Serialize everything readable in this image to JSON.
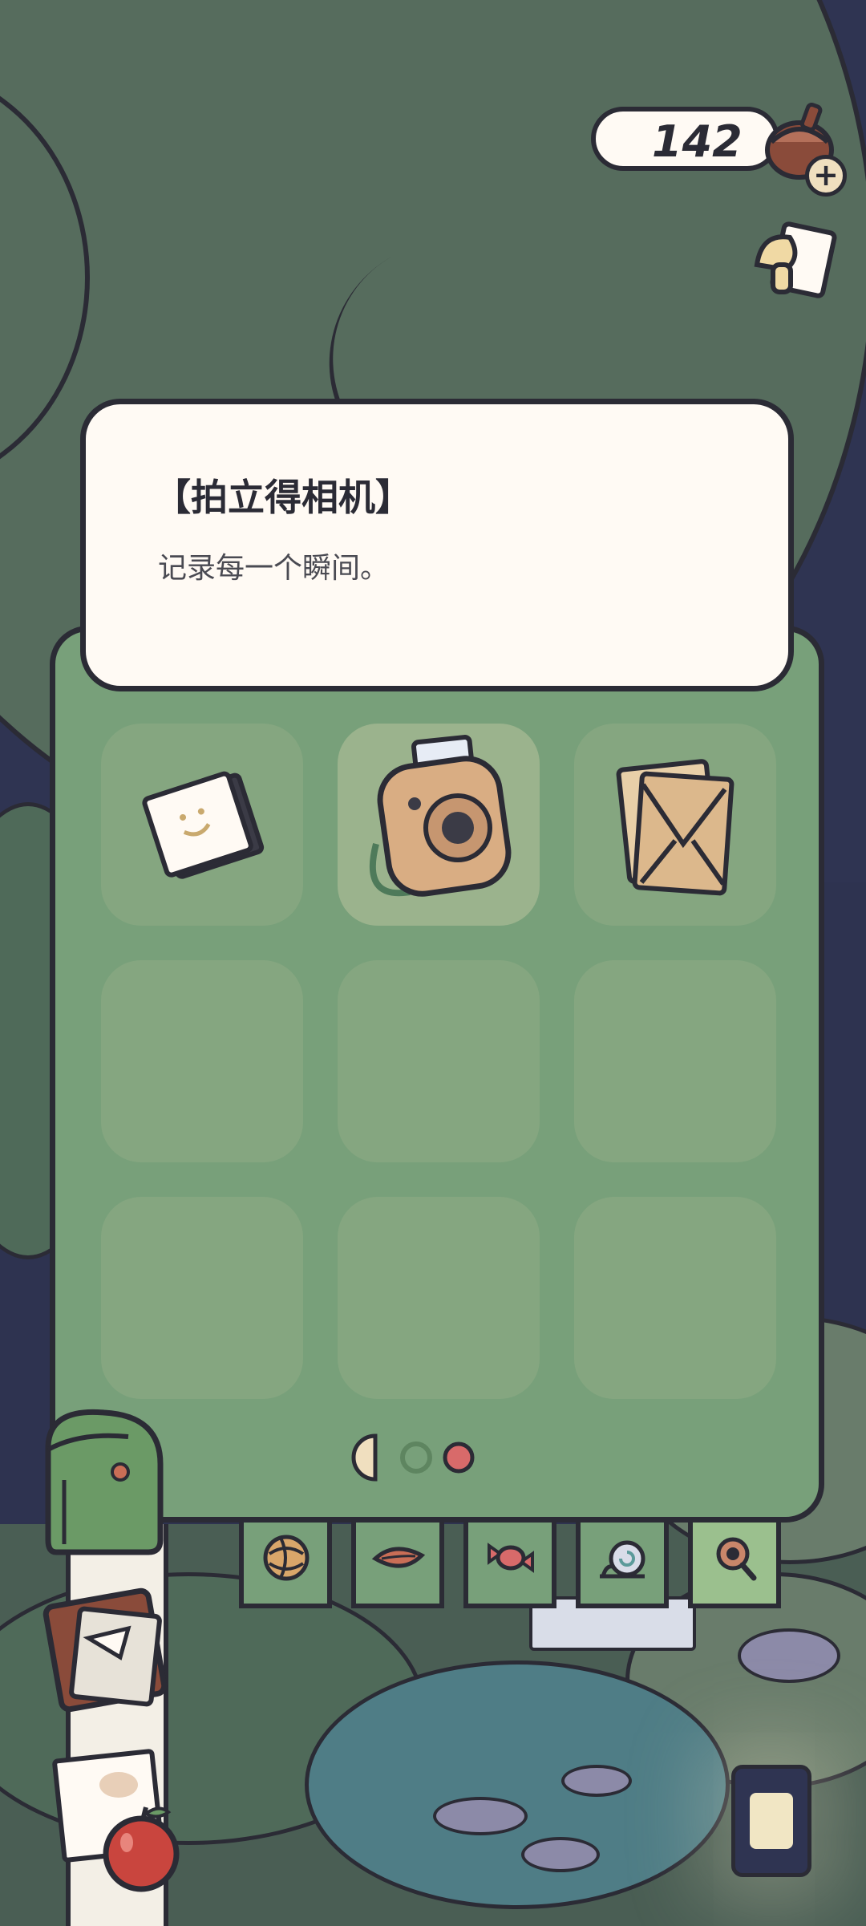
{
  "hud": {
    "acorn_count": "142",
    "acorn_icon": "acorn-icon",
    "add_icon": "plus-icon",
    "memo_icon": "mushroom-note-icon"
  },
  "item_detail": {
    "title": "【拍立得相机】",
    "description": "记录每一个瞬间。"
  },
  "inventory": {
    "slots": [
      {
        "icon": "photo-album-icon",
        "selected": false
      },
      {
        "icon": "instant-camera-icon",
        "selected": true
      },
      {
        "icon": "envelope-icon",
        "selected": false
      },
      {
        "icon": "",
        "selected": false
      },
      {
        "icon": "",
        "selected": false
      },
      {
        "icon": "",
        "selected": false
      },
      {
        "icon": "",
        "selected": false
      },
      {
        "icon": "",
        "selected": false
      },
      {
        "icon": "",
        "selected": false
      }
    ],
    "pages": {
      "current": 3,
      "total": 3
    }
  },
  "category_tabs": [
    {
      "icon": "yarn-ball-icon",
      "active": false
    },
    {
      "icon": "leaf-icon",
      "active": false
    },
    {
      "icon": "candy-icon",
      "active": false
    },
    {
      "icon": "snail-icon",
      "active": false
    },
    {
      "icon": "magnifier-icon",
      "active": true
    }
  ],
  "colors": {
    "panel": "#78a07a",
    "slot": "#85a680",
    "slot_selected": "#9bb38d",
    "card": "#fffaf4",
    "outline": "#2b2b35",
    "page_dot_active": "#d86a6a"
  }
}
